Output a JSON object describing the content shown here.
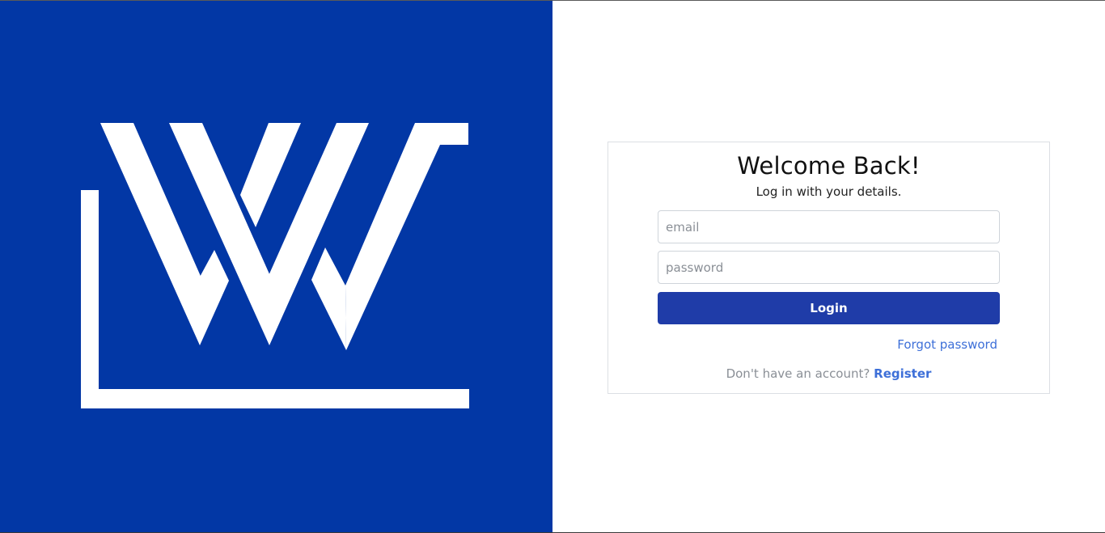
{
  "brand": {
    "logo_icon": "w-monogram-logo",
    "background_color": "#0237a5",
    "logo_color": "#ffffff"
  },
  "login": {
    "title": "Welcome Back!",
    "subtitle": "Log in with your details.",
    "email_placeholder": "email",
    "password_placeholder": "password",
    "login_label": "Login",
    "forgot_password_label": "Forgot password",
    "no_account_text": "Don't have an account?",
    "register_label": "Register",
    "button_color": "#1f3ca8",
    "link_color": "#3d6fd8"
  }
}
